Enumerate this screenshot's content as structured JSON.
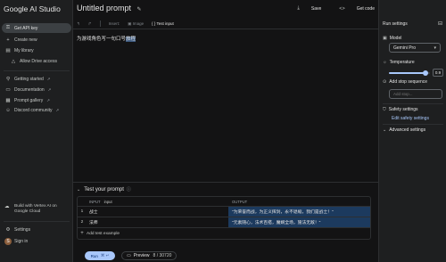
{
  "app": {
    "title": "Google AI Studio"
  },
  "sidebar": {
    "items": [
      {
        "label": "Get API key",
        "icon": "key-icon"
      },
      {
        "label": "Create new",
        "icon": "plus-icon"
      },
      {
        "label": "My library",
        "icon": "library-icon"
      },
      {
        "label": "Allow Drive access",
        "icon": "drive-icon"
      },
      {
        "label": "Getting started",
        "icon": "rocket-icon"
      },
      {
        "label": "Documentation",
        "icon": "doc-icon"
      },
      {
        "label": "Prompt gallery",
        "icon": "gallery-icon"
      },
      {
        "label": "Discord community",
        "icon": "discord-icon"
      }
    ],
    "cloud_label": "Build with Vertex AI on Google Cloud",
    "settings_label": "Settings",
    "signin_label": "Sign in",
    "avatar_letter": "S"
  },
  "header": {
    "prompt_title": "Untitled prompt",
    "save_label": "Save",
    "get_code_label": "Get code"
  },
  "toolbar": {
    "undo": "↰",
    "redo": "↱",
    "insert": "Insert:",
    "image": "Image",
    "test_input": "{ } Test input"
  },
  "prompt": {
    "text_before": "为游戏角色写一句口号",
    "text_highlight": "旅程"
  },
  "test": {
    "title": "Test your prompt",
    "input_tag": "INPUT",
    "input_header": "input",
    "output_header": "OUTPUT",
    "rows": [
      {
        "num": "1",
        "input": "战士",
        "output": "\"为荣誉而战，为正义挥剑，永不退缩，我们是战士！\""
      },
      {
        "num": "2",
        "input": "法师",
        "output": "\"元素随心，法术百搭，魔娴全场，施法无敌！\""
      }
    ],
    "add_label": "Add test example"
  },
  "bottom": {
    "run_label": "Run",
    "run_shortcut": "⌘ ↵",
    "preview_label": "Preview",
    "preview_count": "8 / 30720"
  },
  "run_settings": {
    "title": "Run settings",
    "model_label": "Model",
    "model_value": "Gemini Pro",
    "temperature_label": "Temperature",
    "temperature_value": "0.9",
    "temperature_fraction": 0.9,
    "stop_label": "Add stop sequence",
    "stop_placeholder": "Add stop...",
    "safety_label": "Safety settings",
    "safety_link": "Edit safety settings",
    "advanced_label": "Advanced settings"
  },
  "colors": {
    "accent": "#a8c7fa",
    "output_fill": "#1c3a5e"
  }
}
